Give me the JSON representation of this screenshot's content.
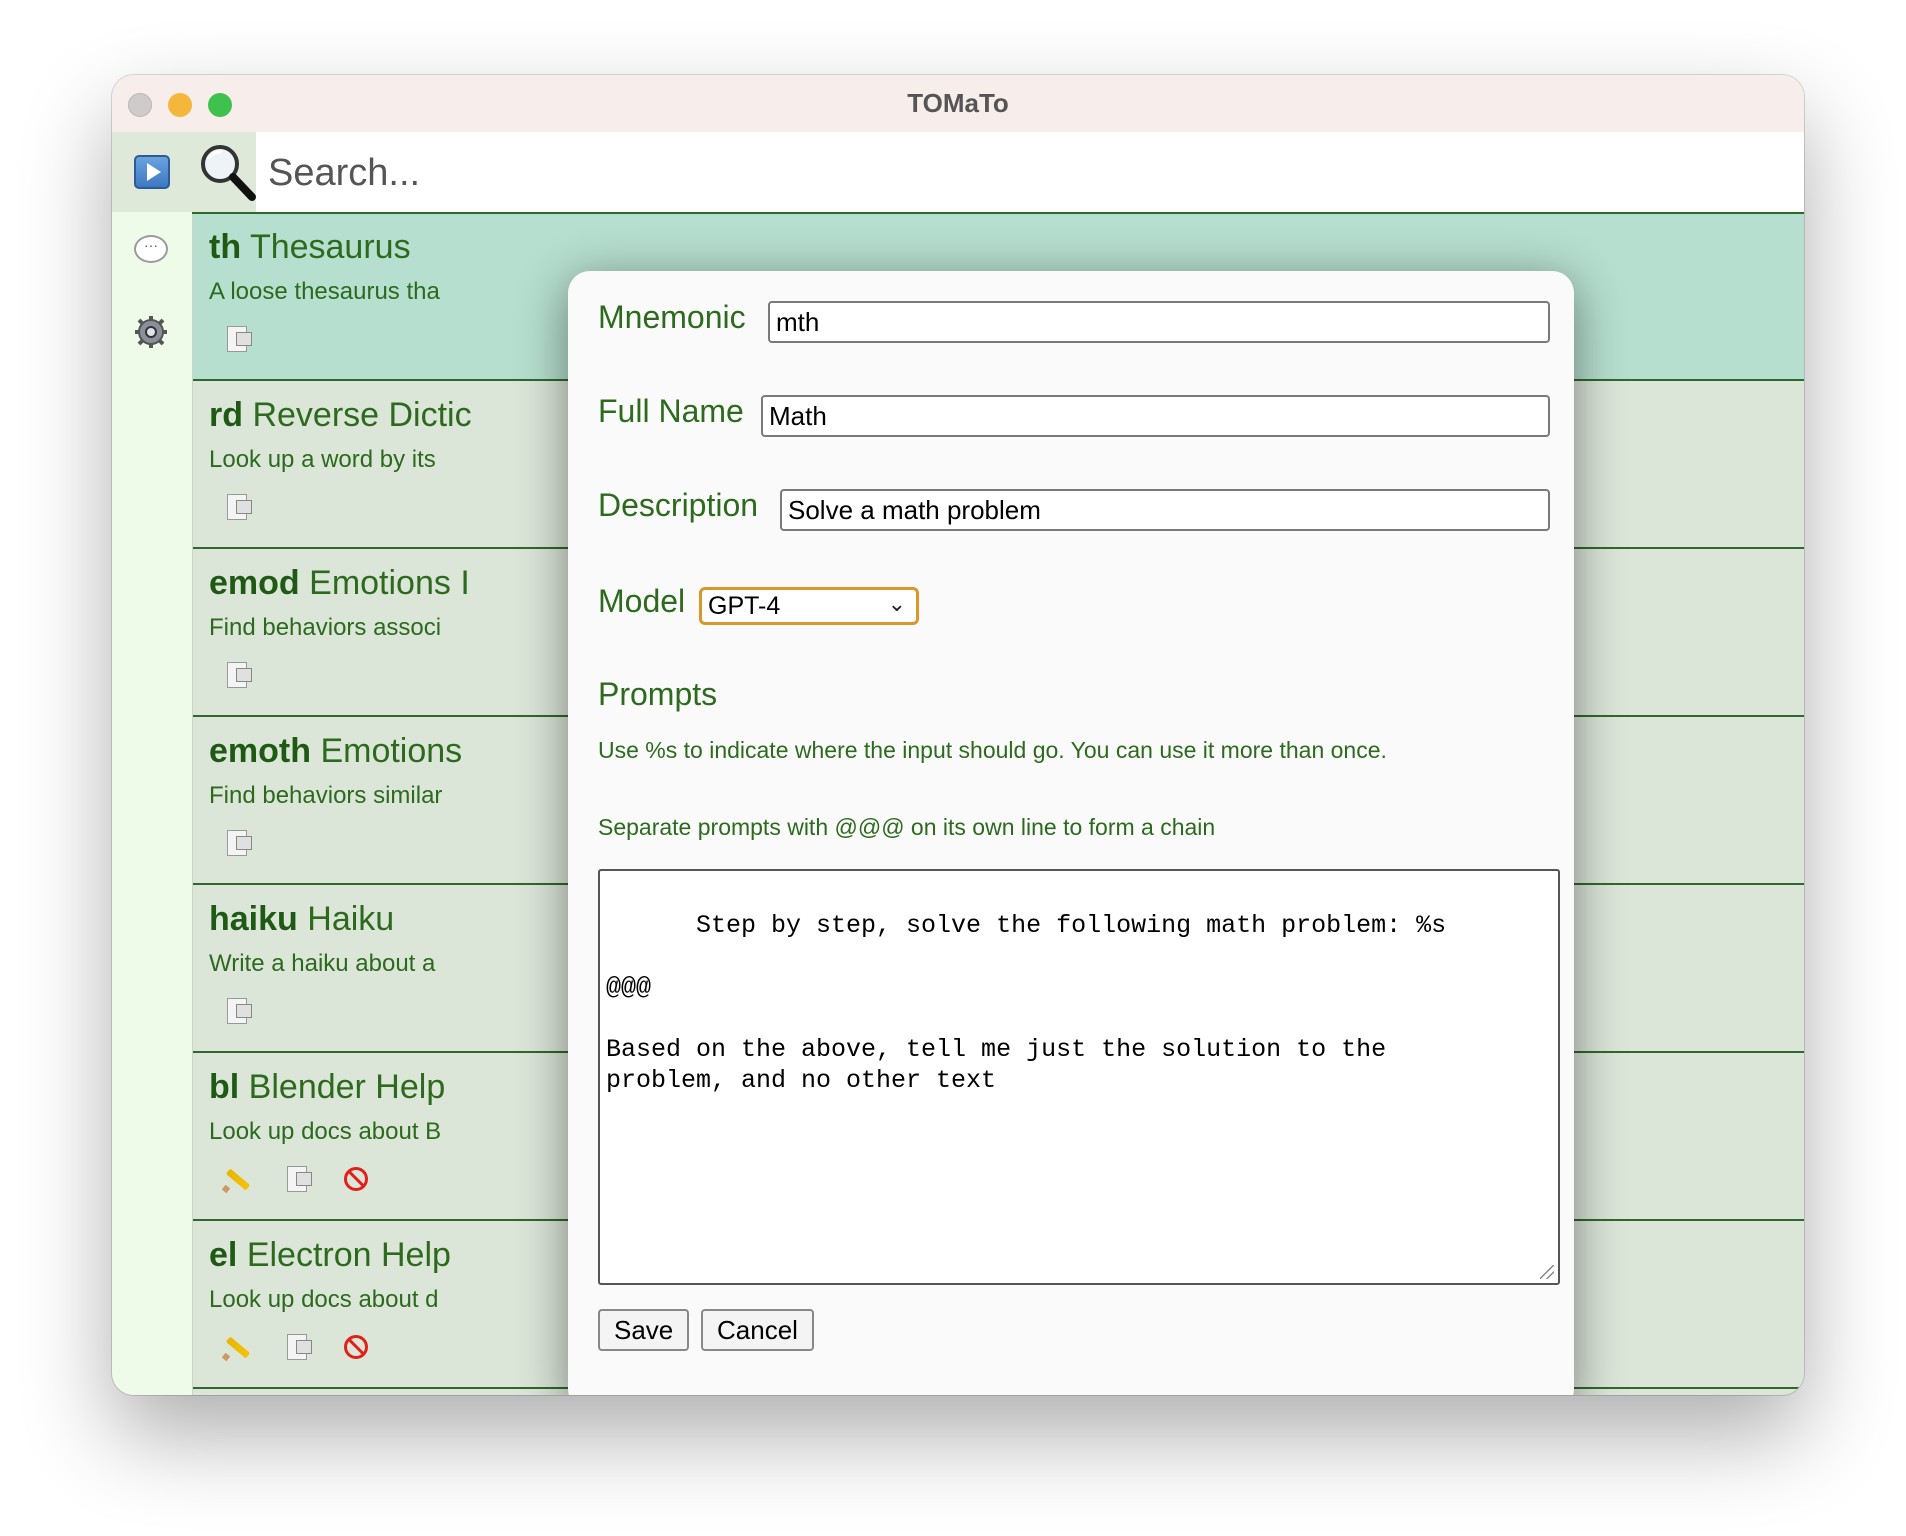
{
  "window": {
    "title": "TOMaTo"
  },
  "search": {
    "placeholder": "Search..."
  },
  "commands": [
    {
      "mnemonic": "th",
      "name": "Thesaurus",
      "description": "A loose thesaurus tha",
      "selected": true,
      "actions": [
        "copy"
      ]
    },
    {
      "mnemonic": "rd",
      "name": "Reverse Dictic",
      "description": "Look up a word by its",
      "selected": false,
      "actions": [
        "copy"
      ]
    },
    {
      "mnemonic": "emod",
      "name": "Emotions I",
      "description": "Find behaviors associ",
      "selected": false,
      "actions": [
        "copy"
      ]
    },
    {
      "mnemonic": "emoth",
      "name": "Emotions",
      "description": "Find behaviors similar",
      "selected": false,
      "actions": [
        "copy"
      ]
    },
    {
      "mnemonic": "haiku",
      "name": "Haiku",
      "description": "Write a haiku about a",
      "selected": false,
      "actions": [
        "copy"
      ]
    },
    {
      "mnemonic": "bl",
      "name": "Blender Help",
      "description": "Look up docs about B",
      "selected": false,
      "actions": [
        "edit",
        "copy",
        "delete"
      ]
    },
    {
      "mnemonic": "el",
      "name": "Electron Help",
      "description": "Look up docs about d",
      "selected": false,
      "actions": [
        "edit",
        "copy",
        "delete"
      ]
    }
  ],
  "dialog": {
    "mnemonic_label": "Mnemonic",
    "mnemonic_value": "mth",
    "fullname_label": "Full Name",
    "fullname_value": "Math",
    "description_label": "Description",
    "description_value": "Solve a math problem",
    "model_label": "Model",
    "model_value": "GPT-4",
    "prompts_title": "Prompts",
    "hint_1": "Use %s to indicate where the input should go. You can use it more than once.",
    "hint_2": "Separate prompts with @@@ on its own line to form a chain",
    "prompt_text": "Step by step, solve the following math problem: %s\n\n@@@\n\nBased on the above, tell me just the solution to the\nproblem, and no other text",
    "save_label": "Save",
    "cancel_label": "Cancel"
  },
  "colors": {
    "accent_green": "#2d6a1e",
    "selected_row": "#b6dfcf",
    "row_bg": "#dbe6d9",
    "focus_orange": "#d9982d"
  }
}
